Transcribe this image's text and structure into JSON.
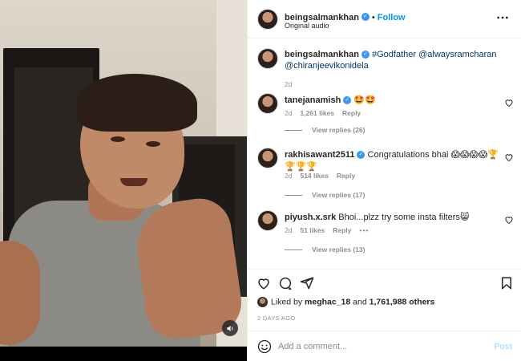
{
  "post": {
    "username": "beingsalmankhan",
    "dot": "•",
    "follow_label": "Follow",
    "audio_label": "Original audio"
  },
  "caption": {
    "username": "beingsalmankhan",
    "hashtag": "#Godfather",
    "mention1": "@alwaysramcharan",
    "mention2": "@chiranjeevikonidela",
    "time": "2d"
  },
  "comments": [
    {
      "username": "tanejanamish",
      "verified": true,
      "text": "🤩🤩",
      "time": "2d",
      "likes": "1,261 likes",
      "reply_label": "Reply",
      "view_replies": "View replies (26)"
    },
    {
      "username": "rakhisawant2511",
      "verified": true,
      "text": "Congratulations bhai 😱😱😱😱🏆🏆🏆🏆",
      "time": "2d",
      "likes": "514 likes",
      "reply_label": "Reply",
      "view_replies": "View replies (17)"
    },
    {
      "username": "piyush.x.srk",
      "verified": false,
      "text": "Bhoi...plzz try some insta filters😸",
      "time": "2d",
      "likes": "51 likes",
      "reply_label": "Reply",
      "more": "•••",
      "view_replies": "View replies (13)"
    }
  ],
  "likes": {
    "prefix": "Liked by",
    "user": "meghac_18",
    "middle": "and",
    "others": "1,761,988 others"
  },
  "post_time": "2 DAYS AGO",
  "add_comment": {
    "placeholder": "Add a comment...",
    "post_label": "Post"
  },
  "icons": {
    "like": "heart-icon",
    "comment": "comment-icon",
    "share": "share-icon",
    "save": "bookmark-icon",
    "more": "more-options-icon",
    "audio": "speaker-icon",
    "emoji": "emoji-icon",
    "verified": "verified-badge-icon"
  },
  "colors": {
    "link_blue": "#0095f6",
    "tag_blue": "#00376b",
    "verified_blue": "#3897f0",
    "muted_gray": "#8e8e8e"
  }
}
